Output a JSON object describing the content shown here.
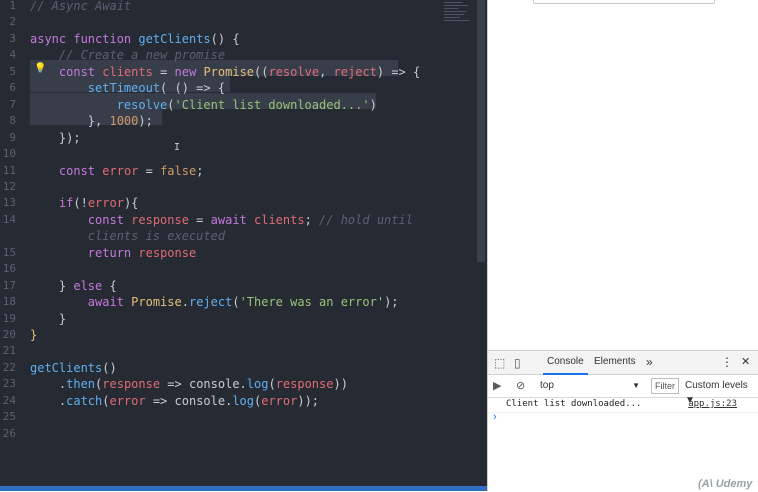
{
  "editor": {
    "line_numbers": [
      "1",
      "2",
      "3",
      "4",
      "5",
      "6",
      "7",
      "8",
      "9",
      "10",
      "11",
      "12",
      "13",
      "14",
      "",
      "15",
      "16",
      "17",
      "18",
      "19",
      "20",
      "21",
      "22",
      "23",
      "24",
      "25",
      "26"
    ],
    "lines": [
      {
        "tokens": [
          {
            "c": "c",
            "t": "// Async Await"
          }
        ]
      },
      {
        "tokens": []
      },
      {
        "tokens": [
          {
            "c": "k",
            "t": "async"
          },
          {
            "c": "p",
            "t": " "
          },
          {
            "c": "k",
            "t": "function"
          },
          {
            "c": "p",
            "t": " "
          },
          {
            "c": "f",
            "t": "getClients"
          },
          {
            "c": "p",
            "t": "() {"
          }
        ]
      },
      {
        "tokens": [
          {
            "c": "c",
            "t": "    // Create a new promise"
          }
        ]
      },
      {
        "tokens": [
          {
            "c": "p",
            "t": "    "
          },
          {
            "c": "k",
            "t": "const"
          },
          {
            "c": "p",
            "t": " "
          },
          {
            "c": "v",
            "t": "clients"
          },
          {
            "c": "p",
            "t": " = "
          },
          {
            "c": "k",
            "t": "new"
          },
          {
            "c": "p",
            "t": " "
          },
          {
            "c": "t",
            "t": "Promise"
          },
          {
            "c": "p",
            "t": "(("
          },
          {
            "c": "v",
            "t": "resolve"
          },
          {
            "c": "p",
            "t": ", "
          },
          {
            "c": "v",
            "t": "reject"
          },
          {
            "c": "p",
            "t": ") => {"
          }
        ]
      },
      {
        "tokens": [
          {
            "c": "p",
            "t": "        "
          },
          {
            "c": "f",
            "t": "setTimeout"
          },
          {
            "c": "p",
            "t": "( () => {"
          }
        ]
      },
      {
        "tokens": [
          {
            "c": "p",
            "t": "            "
          },
          {
            "c": "f",
            "t": "resolve"
          },
          {
            "c": "p",
            "t": "("
          },
          {
            "c": "s",
            "t": "'Client list downloaded...'"
          },
          {
            "c": "p",
            "t": ")"
          }
        ]
      },
      {
        "tokens": [
          {
            "c": "p",
            "t": "        }, "
          },
          {
            "c": "n",
            "t": "1000"
          },
          {
            "c": "p",
            "t": ");"
          }
        ]
      },
      {
        "tokens": [
          {
            "c": "p",
            "t": "    });"
          }
        ]
      },
      {
        "tokens": []
      },
      {
        "tokens": [
          {
            "c": "p",
            "t": "    "
          },
          {
            "c": "k",
            "t": "const"
          },
          {
            "c": "p",
            "t": " "
          },
          {
            "c": "v",
            "t": "error"
          },
          {
            "c": "p",
            "t": " = "
          },
          {
            "c": "n",
            "t": "false"
          },
          {
            "c": "p",
            "t": ";"
          }
        ]
      },
      {
        "tokens": []
      },
      {
        "tokens": [
          {
            "c": "p",
            "t": "    "
          },
          {
            "c": "k",
            "t": "if"
          },
          {
            "c": "p",
            "t": "(!"
          },
          {
            "c": "v",
            "t": "error"
          },
          {
            "c": "p",
            "t": "){"
          }
        ]
      },
      {
        "tokens": [
          {
            "c": "p",
            "t": "        "
          },
          {
            "c": "k",
            "t": "const"
          },
          {
            "c": "p",
            "t": " "
          },
          {
            "c": "v",
            "t": "response"
          },
          {
            "c": "p",
            "t": " = "
          },
          {
            "c": "k",
            "t": "await"
          },
          {
            "c": "p",
            "t": " "
          },
          {
            "c": "v",
            "t": "clients"
          },
          {
            "c": "p",
            "t": "; "
          },
          {
            "c": "c",
            "t": "// hold until"
          }
        ]
      },
      {
        "tokens": [
          {
            "c": "c",
            "t": "        clients is executed"
          }
        ]
      },
      {
        "tokens": [
          {
            "c": "p",
            "t": "        "
          },
          {
            "c": "k",
            "t": "return"
          },
          {
            "c": "p",
            "t": " "
          },
          {
            "c": "v",
            "t": "response"
          }
        ]
      },
      {
        "tokens": []
      },
      {
        "tokens": [
          {
            "c": "p",
            "t": "    } "
          },
          {
            "c": "k",
            "t": "else"
          },
          {
            "c": "p",
            "t": " {"
          }
        ]
      },
      {
        "tokens": [
          {
            "c": "p",
            "t": "        "
          },
          {
            "c": "k",
            "t": "await"
          },
          {
            "c": "p",
            "t": " "
          },
          {
            "c": "t",
            "t": "Promise"
          },
          {
            "c": "p",
            "t": "."
          },
          {
            "c": "f",
            "t": "reject"
          },
          {
            "c": "p",
            "t": "("
          },
          {
            "c": "s",
            "t": "'There was an error'"
          },
          {
            "c": "p",
            "t": ");"
          }
        ]
      },
      {
        "tokens": [
          {
            "c": "p",
            "t": "    }"
          }
        ]
      },
      {
        "tokens": [
          {
            "c": "t",
            "t": "}"
          }
        ]
      },
      {
        "tokens": []
      },
      {
        "tokens": [
          {
            "c": "f",
            "t": "getClients"
          },
          {
            "c": "p",
            "t": "()"
          }
        ]
      },
      {
        "tokens": [
          {
            "c": "p",
            "t": "    ."
          },
          {
            "c": "f",
            "t": "then"
          },
          {
            "c": "p",
            "t": "("
          },
          {
            "c": "v",
            "t": "response"
          },
          {
            "c": "p",
            "t": " => "
          },
          {
            "c": "p",
            "t": "console."
          },
          {
            "c": "f",
            "t": "log"
          },
          {
            "c": "p",
            "t": "("
          },
          {
            "c": "v",
            "t": "response"
          },
          {
            "c": "p",
            "t": "))"
          }
        ]
      },
      {
        "tokens": [
          {
            "c": "p",
            "t": "    ."
          },
          {
            "c": "f",
            "t": "catch"
          },
          {
            "c": "p",
            "t": "("
          },
          {
            "c": "v",
            "t": "error"
          },
          {
            "c": "p",
            "t": " => "
          },
          {
            "c": "p",
            "t": "console."
          },
          {
            "c": "f",
            "t": "log"
          },
          {
            "c": "p",
            "t": "("
          },
          {
            "c": "v",
            "t": "error"
          },
          {
            "c": "p",
            "t": "));"
          }
        ]
      },
      {
        "tokens": []
      },
      {
        "tokens": []
      }
    ]
  },
  "devtools": {
    "tabs": [
      {
        "label": "Console",
        "active": true
      },
      {
        "label": "Elements",
        "active": false
      }
    ],
    "more": "»",
    "menu": "⋮",
    "close": "✕",
    "context": "top",
    "filter_placeholder": "Filter",
    "levels": "Custom levels ▼",
    "log_message": "Client list downloaded...",
    "log_source": "app.js:23",
    "prompt": "›"
  },
  "colors": {
    "editor_bg": "#262a33",
    "keyword": "#c678dd",
    "function": "#61afef",
    "variable": "#e06c75",
    "string": "#98c379",
    "number": "#d19a66",
    "type": "#e5c07b",
    "comment": "#596171",
    "accent": "#1a73e8"
  },
  "watermark": "(A\\ Udemy"
}
